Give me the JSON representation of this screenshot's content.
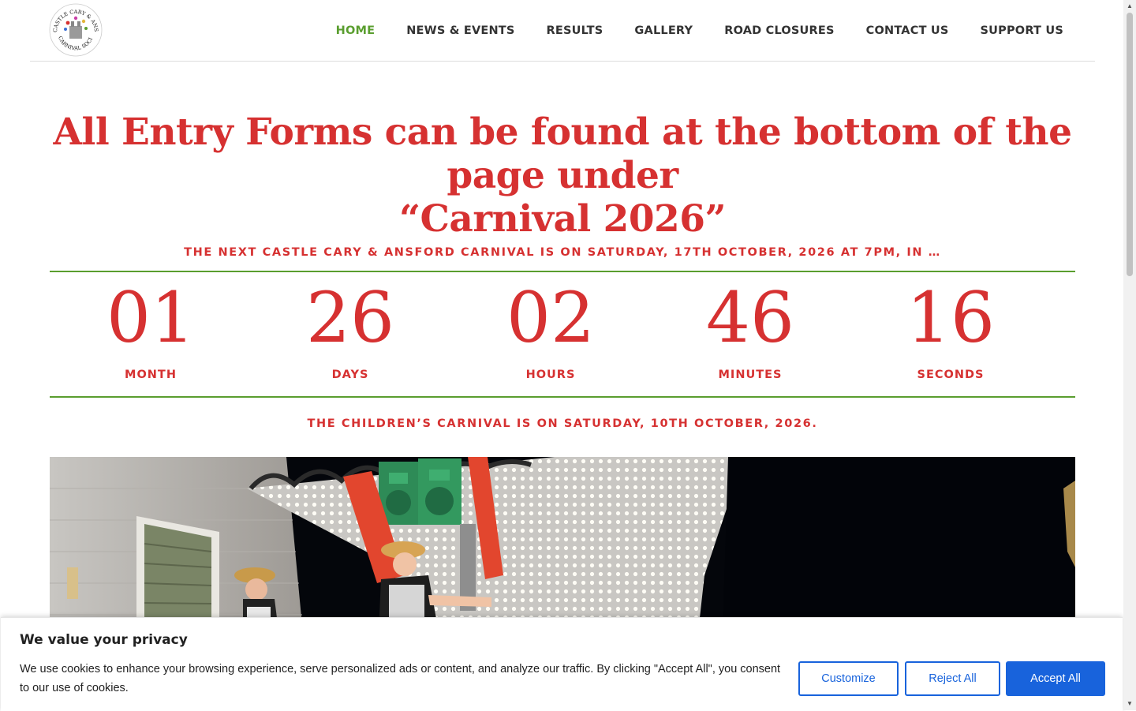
{
  "header": {
    "logo_alt": "Castle Cary & Ansford Carnival Society",
    "logo_text_top": "CASTLE CARY & ANSFORD",
    "logo_text_bottom": "CARNIVAL SOCIETY",
    "nav": [
      {
        "label": "HOME",
        "active": true
      },
      {
        "label": "NEWS & EVENTS",
        "active": false
      },
      {
        "label": "RESULTS",
        "active": false
      },
      {
        "label": "GALLERY",
        "active": false
      },
      {
        "label": "ROAD CLOSURES",
        "active": false
      },
      {
        "label": "CONTACT US",
        "active": false
      },
      {
        "label": "SUPPORT US",
        "active": false
      }
    ]
  },
  "hero": {
    "headline_line1": "All Entry Forms can be found at the bottom of the page under",
    "headline_line2": "“Carnival 2026”",
    "next_carnival": "THE NEXT CASTLE CARY & ANSFORD CARNIVAL IS ON SATURDAY, 17TH OCTOBER, 2026 AT 7PM, IN …",
    "childrens_carnival": "THE CHILDREN’S CARNIVAL IS ON SATURDAY, 10TH OCTOBER, 2026."
  },
  "countdown": [
    {
      "value": "01",
      "label": "MONTH"
    },
    {
      "value": "26",
      "label": "DAYS"
    },
    {
      "value": "02",
      "label": "HOURS"
    },
    {
      "value": "46",
      "label": "MINUTES"
    },
    {
      "value": "16",
      "label": "SECONDS"
    }
  ],
  "cookie_banner": {
    "title": "We value your privacy",
    "text": "We use cookies to enhance your browsing experience, serve personalized ads or content, and analyze our traffic. By clicking \"Accept All\", you consent to our use of cookies.",
    "customize": "Customize",
    "reject": "Reject All",
    "accept": "Accept All"
  },
  "colors": {
    "accent_red": "#d63131",
    "accent_green": "#5a9e2f",
    "button_blue": "#1863dc"
  }
}
